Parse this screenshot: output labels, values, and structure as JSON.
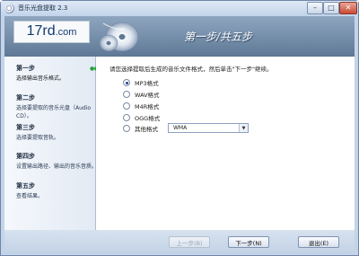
{
  "window": {
    "title": "音乐光盘提取 2.3",
    "minimize": "–",
    "maximize": "□",
    "close": "✕"
  },
  "header": {
    "logo_main": "17rd",
    "logo_domain": ".com",
    "step_title": "第一步/共五步"
  },
  "steps": [
    {
      "name": "第一步",
      "desc": "选择输出音乐格式。",
      "active": true
    },
    {
      "name": "第二步",
      "desc": "选择要提取的音乐光盘（Audio CD）。",
      "active": false
    },
    {
      "name": "第三步",
      "desc": "选择要提取音轨。",
      "active": false
    },
    {
      "name": "第四步",
      "desc": "设置输出路径、输出的音乐音质。",
      "active": false
    },
    {
      "name": "第五步",
      "desc": "查看结果。",
      "active": false
    }
  ],
  "active_indicator": "●●●",
  "content": {
    "instruction": "请您选择提取后生成的音乐文件格式，然后单击\"下一步\"继续。",
    "formats": [
      {
        "label": "MP3格式",
        "checked": true
      },
      {
        "label": "WAV格式",
        "checked": false
      },
      {
        "label": "M4R格式",
        "checked": false
      },
      {
        "label": "OGG格式",
        "checked": false
      },
      {
        "label": "其他格式",
        "checked": false
      }
    ],
    "other_format_value": "WMA",
    "dropdown_arrow": "▼"
  },
  "buttons": {
    "prev": "上一步(B)",
    "next": "下一步(N)",
    "exit": "退出(E)"
  },
  "colors": {
    "header_bg": "#5e7896",
    "window_frame": "#c4d4e8",
    "active_dots": "#28a03c"
  }
}
